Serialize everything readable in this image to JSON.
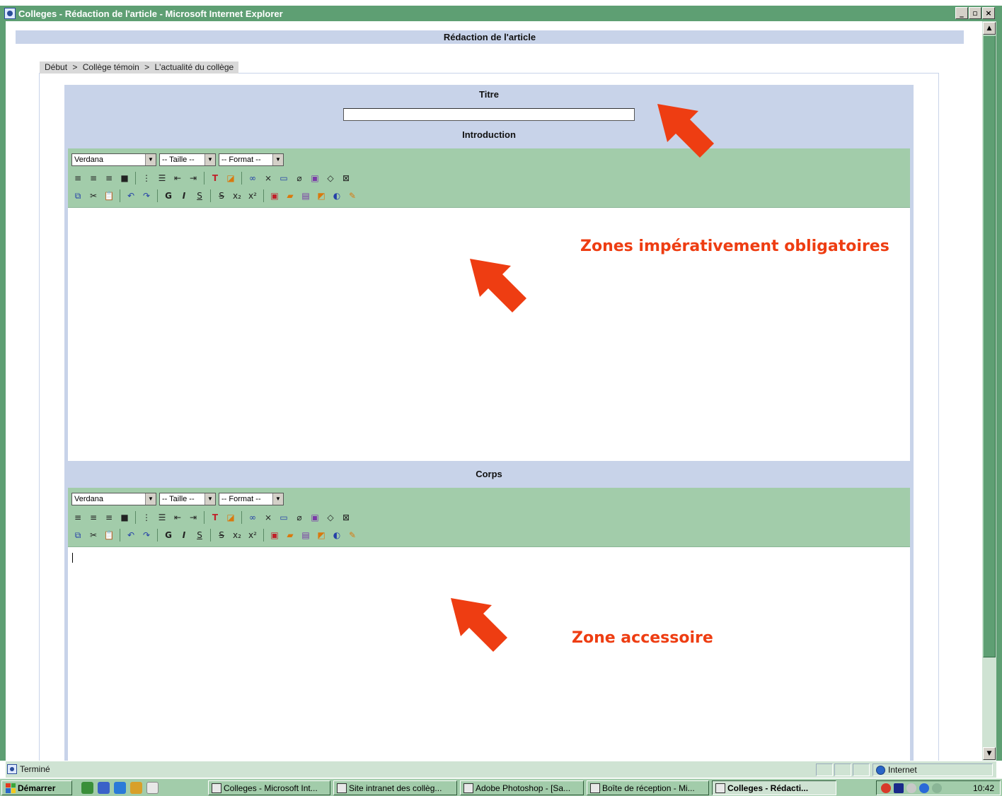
{
  "window": {
    "title": "Colleges - Rédaction de l'article - Microsoft Internet Explorer",
    "controls": {
      "minimize": "_",
      "maximize": "▫",
      "close": "×"
    }
  },
  "page": {
    "header": "Rédaction de l'article",
    "breadcrumb": [
      "Début",
      "Collège témoin",
      "L'actualité du collège"
    ],
    "breadcrumb_separator": ">"
  },
  "form": {
    "titre_label": "Titre",
    "titre_value": "",
    "intro_label": "Introduction",
    "corps_label": "Corps"
  },
  "editor_toolbar": {
    "font": "Verdana",
    "size": "-- Taille --",
    "format": "-- Format --"
  },
  "annotations": {
    "mandatory": "Zones impérativement obligatoires",
    "optional": "Zone accessoire",
    "color": "#ee3d12"
  },
  "status_bar": {
    "status": "Terminé",
    "zone": "Internet"
  },
  "taskbar": {
    "start": "Démarrer",
    "tasks": [
      {
        "label": "Colleges - Microsoft Int...",
        "active": false
      },
      {
        "label": "Site intranet des collèg...",
        "active": false
      },
      {
        "label": "Adobe Photoshop - [Sa...",
        "active": false
      },
      {
        "label": "Boîte de réception - Mi...",
        "active": false
      },
      {
        "label": "Colleges - Rédacti...",
        "active": true
      }
    ],
    "clock": "10:42"
  },
  "colors": {
    "window_frame": "#5e9f73",
    "toolbar": "#a2ccaa",
    "panel": "#c8d3e9"
  }
}
